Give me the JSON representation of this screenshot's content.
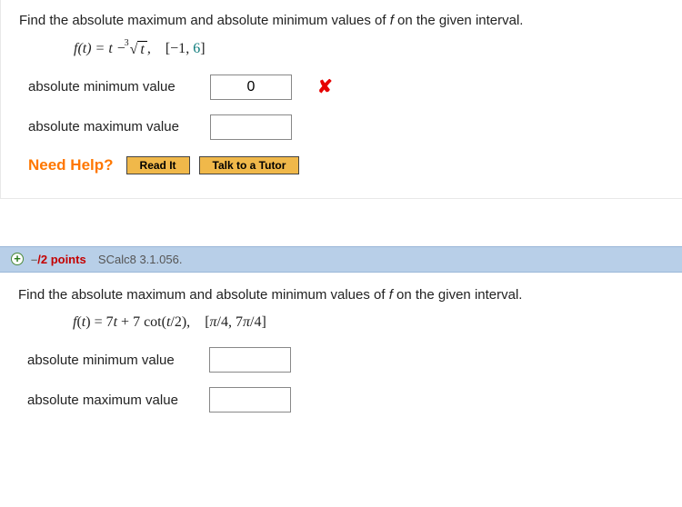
{
  "q1": {
    "prompt_pre": "Find the absolute maximum and absolute minimum values of ",
    "prompt_f": "f",
    "prompt_post": " on the given interval.",
    "eq_lhs": "f(t) = t − ",
    "eq_rad": "t",
    "eq_comma": ",",
    "interval": "[−1, 6]",
    "min_label": "absolute minimum value",
    "min_value": "0",
    "wrong": "✘",
    "max_label": "absolute maximum value",
    "max_value": "",
    "need_help": "Need Help?",
    "read_it": "Read It",
    "talk": "Talk to a Tutor"
  },
  "q2": {
    "header_expand": "+",
    "header_un": "–",
    "header_total": "/2 points",
    "header_ref": "SCalc8 3.1.056.",
    "prompt_pre": "Find the absolute maximum and absolute minimum values of ",
    "prompt_f": "f",
    "prompt_post": " on the given interval.",
    "eq": "f(t) = 7t + 7 cot(t/2),",
    "interval": "[π/4, 7π/4]",
    "min_label": "absolute minimum value",
    "min_value": "",
    "max_label": "absolute maximum value",
    "max_value": ""
  }
}
